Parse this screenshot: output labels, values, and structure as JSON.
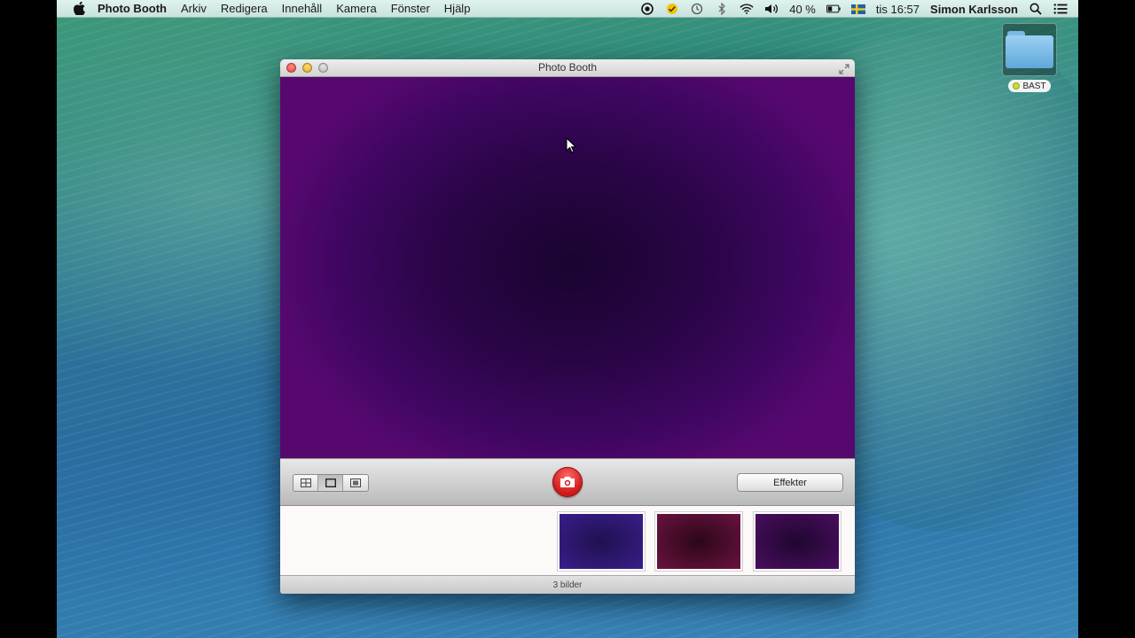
{
  "menubar": {
    "app_name": "Photo Booth",
    "menus": [
      "Arkiv",
      "Redigera",
      "Innehåll",
      "Kamera",
      "Fönster",
      "Hjälp"
    ],
    "battery": "40 %",
    "clock": "tis 16:57",
    "user": "Simon Karlsson",
    "status_icons": [
      "record-icon",
      "check-icon",
      "time-machine-icon",
      "bluetooth-icon",
      "wifi-icon",
      "volume-icon",
      "battery-icon",
      "swedish-flag-icon",
      "search-icon",
      "notification-list-icon"
    ]
  },
  "desktop": {
    "folder_label": "BAST"
  },
  "window": {
    "title": "Photo Booth",
    "effects_label": "Effekter",
    "photo_count": "3 bilder",
    "thumbnails": [
      "photo-1",
      "photo-2",
      "photo-3"
    ],
    "view_modes": [
      "four-up",
      "single",
      "video"
    ],
    "active_view_mode": "single"
  },
  "colors": {
    "preview": "#3d0660",
    "capture_button": "#d01818"
  }
}
